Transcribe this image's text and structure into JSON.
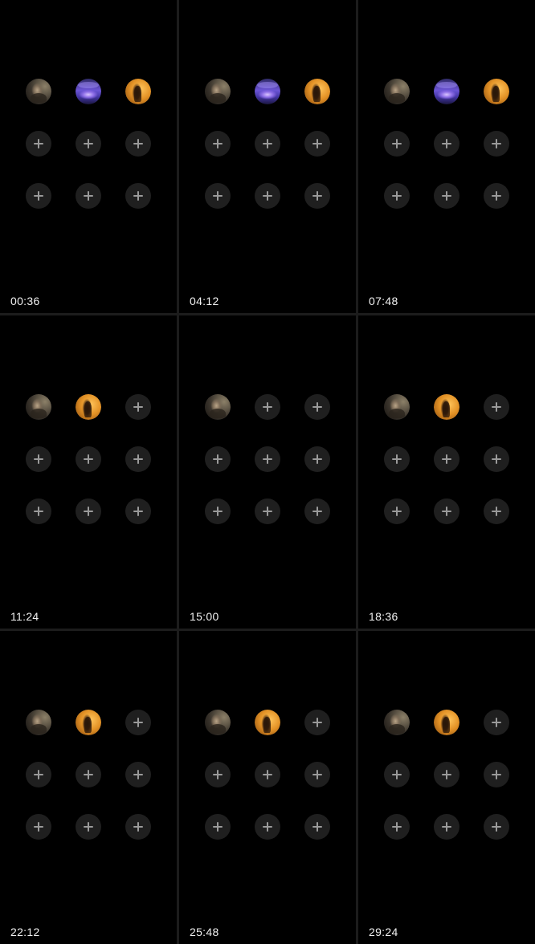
{
  "timestamps": [
    "00:36",
    "04:12",
    "07:48",
    "11:24",
    "15:00",
    "18:36",
    "22:12",
    "25:48",
    "29:24"
  ],
  "frames": [
    {
      "time": "00:36",
      "avatars": [
        "a",
        "b",
        "c"
      ]
    },
    {
      "time": "04:12",
      "avatars": [
        "a",
        "b",
        "c"
      ]
    },
    {
      "time": "07:48",
      "avatars": [
        "a",
        "b",
        "c"
      ]
    },
    {
      "time": "11:24",
      "avatars": [
        "a",
        "c"
      ]
    },
    {
      "time": "15:00",
      "avatars": [
        "a"
      ]
    },
    {
      "time": "18:36",
      "avatars": [
        "a",
        "c"
      ]
    },
    {
      "time": "22:12",
      "avatars": [
        "a",
        "c"
      ]
    },
    {
      "time": "25:48",
      "avatars": [
        "a",
        "c"
      ]
    },
    {
      "time": "29:24",
      "avatars": [
        "a",
        "c"
      ]
    }
  ],
  "slots_per_frame": 9,
  "add_icon": "plus-icon",
  "colors": {
    "frame_background": "#000000",
    "separator": "#1c1c1c",
    "slot_background": "#1f1f1f",
    "plus_icon": "#9a9a9a",
    "timestamp_text": "#f2f2f2"
  }
}
